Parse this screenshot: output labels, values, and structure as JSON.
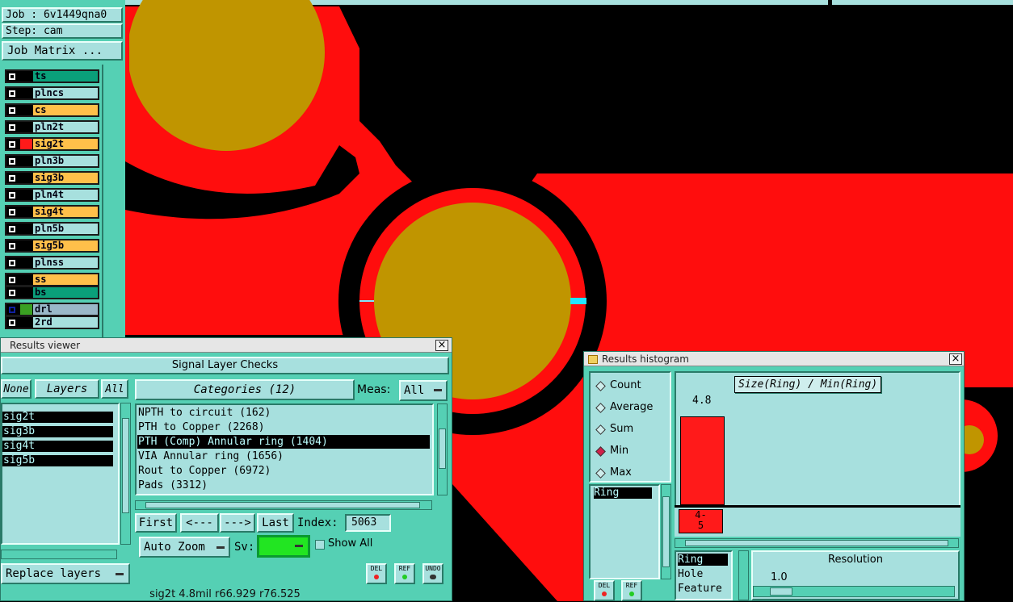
{
  "job": {
    "job_label": "Job : 6v1449qna0",
    "step_label": "Step: cam",
    "matrix_button": "Job Matrix ..."
  },
  "layers": [
    {
      "name": "ts",
      "color": "#0aa07a",
      "swatch": "#000"
    },
    {
      "name": "plncs",
      "color": "#a7e0de",
      "swatch": "#000"
    },
    {
      "name": "cs",
      "color": "#ffc04a",
      "swatch": "#000"
    },
    {
      "name": "pln2t",
      "color": "#a7e0de",
      "swatch": "#000"
    },
    {
      "name": "sig2t",
      "color": "#ffc04a",
      "swatch": "#ff1a1a"
    },
    {
      "name": "pln3b",
      "color": "#a7e0de",
      "swatch": "#000"
    },
    {
      "name": "sig3b",
      "color": "#ffc04a",
      "swatch": "#000"
    },
    {
      "name": "pln4t",
      "color": "#a7e0de",
      "swatch": "#000"
    },
    {
      "name": "sig4t",
      "color": "#ffc04a",
      "swatch": "#000"
    },
    {
      "name": "pln5b",
      "color": "#a7e0de",
      "swatch": "#000"
    },
    {
      "name": "sig5b",
      "color": "#ffc04a",
      "swatch": "#000"
    },
    {
      "name": "plnss",
      "color": "#a7e0de",
      "swatch": "#000"
    },
    {
      "name": "ss",
      "color": "#ffc04a",
      "swatch": "#000"
    },
    {
      "name": "bs",
      "color": "#0aa07a",
      "swatch": "#000"
    },
    {
      "name": "drl",
      "color": "#9ab8c8",
      "swatch": "#3aa022"
    },
    {
      "name": "2rd",
      "color": "#a7e0de",
      "swatch": "#000"
    }
  ],
  "results_viewer": {
    "title": "Results viewer",
    "header": "Signal Layer Checks",
    "none_button": "None",
    "layers_button": "Layers",
    "all_button": "All",
    "categories_button": "Categories (12)",
    "meas_label": "Meas:",
    "meas_value": "All",
    "layer_list": [
      "sig2t",
      "sig3b",
      "sig4t",
      "sig5b"
    ],
    "categories": [
      {
        "label": "NPTH to circuit (162)",
        "selected": false
      },
      {
        "label": "PTH to Copper (2268)",
        "selected": false
      },
      {
        "label": "PTH (Comp) Annular ring (1404)",
        "selected": true
      },
      {
        "label": "VIA Annular ring (1656)",
        "selected": false
      },
      {
        "label": "Rout to Copper (6972)",
        "selected": false
      },
      {
        "label": "Pads (3312)",
        "selected": false
      }
    ],
    "nav": {
      "first": "First",
      "prev": "<---",
      "next": "--->",
      "last": "Last"
    },
    "index_label": "Index:",
    "index_value": "5063",
    "auto_zoom": "Auto Zoom",
    "sv_label": "Sv:",
    "show_all": "Show All",
    "replace_layers": "Replace layers",
    "icon_del": "DEL",
    "icon_ref": "REF",
    "icon_undo": "UNDO",
    "status": "sig2t 4.8mil  r66.929  r76.525"
  },
  "histogram": {
    "title": "Results histogram",
    "modes": [
      {
        "label": "Count",
        "on": false
      },
      {
        "label": "Average",
        "on": false
      },
      {
        "label": "Sum",
        "on": false
      },
      {
        "label": "Min",
        "on": true
      },
      {
        "label": "Max",
        "on": false
      }
    ],
    "field_list": [
      "Ring"
    ],
    "chart_title": "Size(Ring) / Min(Ring)",
    "bar_value": "4.8",
    "bar_bin": "4-\n5",
    "bar_fraction": 0.92,
    "x_fields": [
      "Ring",
      "Hole",
      "Feature"
    ],
    "resolution_label": "Resolution",
    "resolution_value": "1.0",
    "icon_del": "DEL",
    "icon_ref": "REF"
  },
  "colors": {
    "panel": "#55d0b4",
    "light": "#a7e0de",
    "copper": "#ff0d0d",
    "pad": "#c09500",
    "bar": "#ff1a1a"
  }
}
